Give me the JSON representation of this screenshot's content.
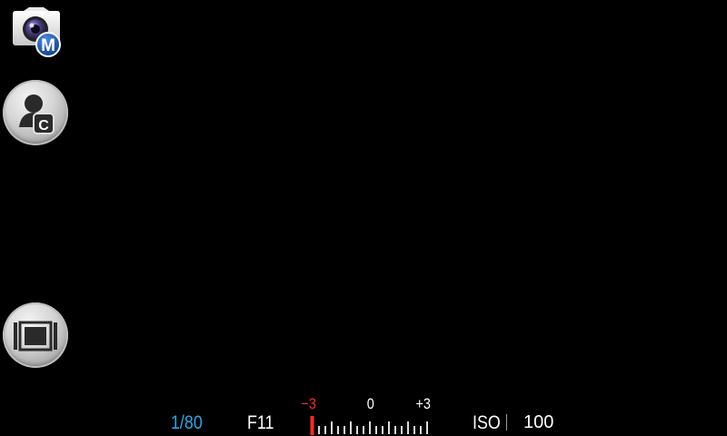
{
  "mode": {
    "icon": "camera-manual-mode-icon",
    "badge": "M",
    "badge_color": "#1e66c8"
  },
  "side_buttons": [
    {
      "name": "custom-settings",
      "icon": "user-custom-icon",
      "badge": "C"
    },
    {
      "name": "display-mode",
      "icon": "display-frame-icon"
    }
  ],
  "exposure": {
    "shutter_speed": "1/80",
    "shutter_color": "#2aa7e8",
    "aperture": "F11",
    "ev_scale": {
      "min_label": "−3",
      "zero_label": "0",
      "max_label": "+3",
      "min_color": "#ff2a2a",
      "current_value": -3,
      "range": [
        -3,
        3
      ]
    },
    "iso_label": "ISO",
    "iso_value": "100"
  }
}
